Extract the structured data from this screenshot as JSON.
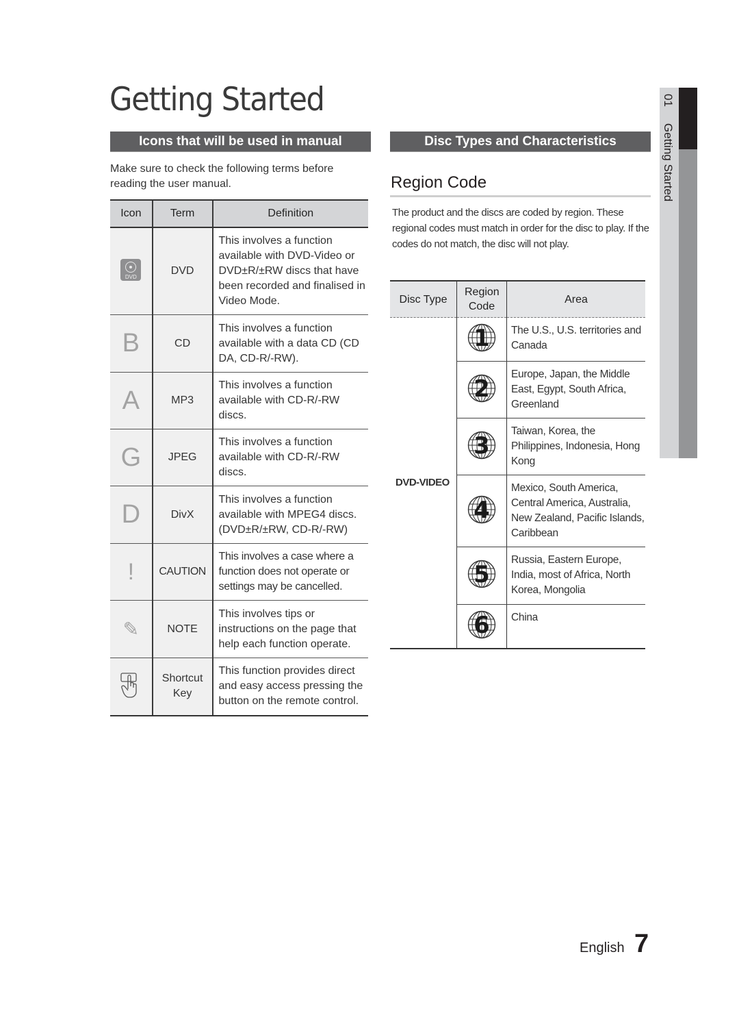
{
  "page_title": "Getting Started",
  "left_section": {
    "header": "Icons that will be used in manual",
    "intro": "Make sure to check the following terms before reading the user manual.",
    "table": {
      "columns": [
        "Icon",
        "Term",
        "Definition"
      ],
      "rows": [
        {
          "icon": "dvd-disc-icon",
          "icon_label": "DVD",
          "term": "DVD",
          "definition": "This involves a function available with DVD-Video or DVD±R/±RW discs that have been recorded and finalised in Video Mode."
        },
        {
          "icon": "B",
          "term": "CD",
          "definition": "This involves a function available with a data CD (CD DA, CD-R/-RW)."
        },
        {
          "icon": "A",
          "term": "MP3",
          "definition": "This involves a function available with CD-R/-RW discs."
        },
        {
          "icon": "G",
          "term": "JPEG",
          "definition": "This involves a function available with CD-R/-RW discs."
        },
        {
          "icon": "D",
          "term": "DivX",
          "definition": "This involves a function available with MPEG4 discs. (DVD±R/±RW, CD-R/-RW)"
        },
        {
          "icon": "!",
          "term": "CAUTION",
          "definition": "This involves a case where a function does not operate or settings may be cancelled."
        },
        {
          "icon": "✎",
          "term": "NOTE",
          "definition": "This involves tips or instructions on the page that help each function operate."
        },
        {
          "icon": "hand-press-icon",
          "term": "Shortcut Key",
          "definition": "This function provides direct and easy access pressing the button on the remote control."
        }
      ]
    }
  },
  "right_section": {
    "header": "Disc Types and Characteristics",
    "subtitle": "Region Code",
    "description": "The product and the discs are coded by region. These regional codes must match in order for the disc to play. If the codes do not match, the disc will not play.",
    "table": {
      "columns": [
        "Disc Type",
        "Region Code",
        "Area"
      ],
      "disc_type": "DVD-VIDEO",
      "rows": [
        {
          "code": "1",
          "area": "The U.S., U.S. territories and Canada"
        },
        {
          "code": "2",
          "area": "Europe, Japan, the Middle East, Egypt, South Africa, Greenland"
        },
        {
          "code": "3",
          "area": "Taiwan, Korea, the Philippines, Indonesia, Hong Kong"
        },
        {
          "code": "4",
          "area": "Mexico, South America, Central America, Australia, New Zealand, Pacific Islands, Caribbean"
        },
        {
          "code": "5",
          "area": "Russia, Eastern Europe, India, most of Africa, North Korea, Mongolia"
        },
        {
          "code": "6",
          "area": "China"
        }
      ]
    }
  },
  "side_tab": {
    "number": "01",
    "label": "Getting Started"
  },
  "footer": {
    "language": "English",
    "page_number": "7"
  },
  "colors": {
    "section_bar": "#5f5f61",
    "table_header": "#d4d5d7",
    "side_tab_dark": "#231f20",
    "side_tab_mid": "#949597",
    "side_tab_light": "#d3d4d6"
  }
}
